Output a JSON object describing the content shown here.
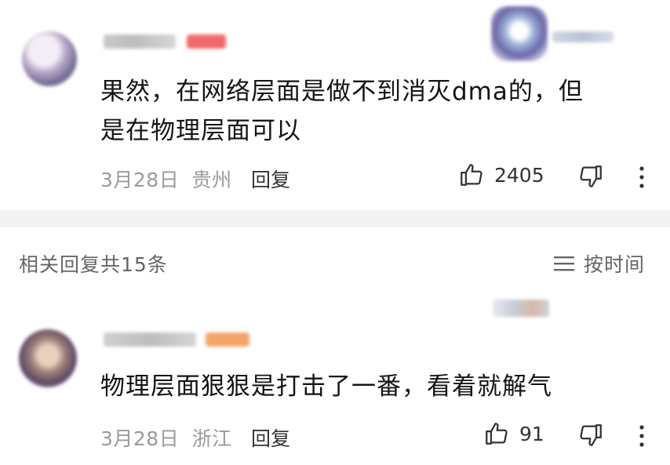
{
  "comment1": {
    "text_line1": "果然，在网络层面是做不到消灭dma的，但",
    "text_line2": "是在物理层面可以",
    "date": "3月28日",
    "location": "贵州",
    "reply_label": "回复",
    "likes": "2405"
  },
  "replies_header": {
    "title": "相关回复共15条",
    "sort_label": "按时间"
  },
  "comment2": {
    "text": "物理层面狠狠是打击了一番，看着就解气",
    "date": "3月28日",
    "location": "浙江",
    "reply_label": "回复",
    "likes": "91"
  },
  "icons": [
    "avatar",
    "thumbs-up-icon",
    "thumbs-down-icon",
    "more-vertical-icon",
    "sort-list-icon"
  ],
  "colors": {
    "text": "#141414",
    "meta": "#9a9a9a",
    "divider": "#f2f2f2",
    "badge_red": "#f06a6a",
    "badge_orange": "#f4a46a"
  }
}
